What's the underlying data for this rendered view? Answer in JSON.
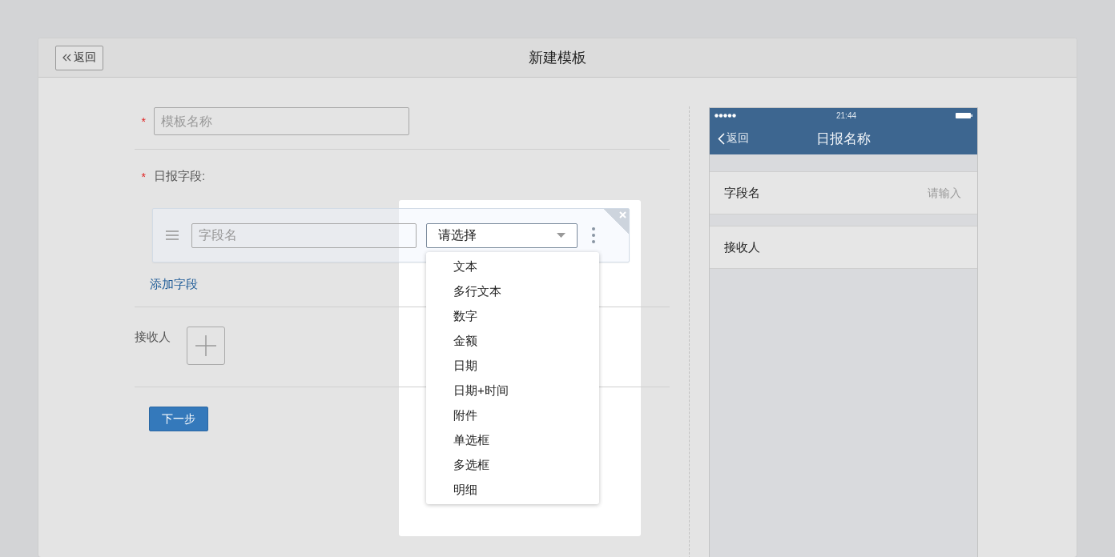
{
  "header": {
    "back_button": "返回",
    "title": "新建模板"
  },
  "form": {
    "template_name": {
      "required_mark": "*",
      "placeholder": "模板名称"
    },
    "fields_section": {
      "required_mark": "*",
      "label": "日报字段:",
      "fields": [
        {
          "name_placeholder": "字段名",
          "type_value": "请选择",
          "dropdown": {
            "expanded": true,
            "options": [
              "文本",
              "多行文本",
              "数字",
              "金额",
              "日期",
              "日期+时间",
              "附件",
              "单选框",
              "多选框",
              "明细"
            ]
          }
        }
      ],
      "add_link": "添加字段"
    },
    "recipients": {
      "label": "接收人"
    },
    "next_button": "下一步"
  },
  "preview": {
    "status_bar": {
      "time": "21:44"
    },
    "nav": {
      "back": "返回",
      "title": "日报名称"
    },
    "rows": [
      {
        "label": "字段名",
        "placeholder": "请输入"
      },
      {
        "label": "接收人"
      }
    ]
  }
}
